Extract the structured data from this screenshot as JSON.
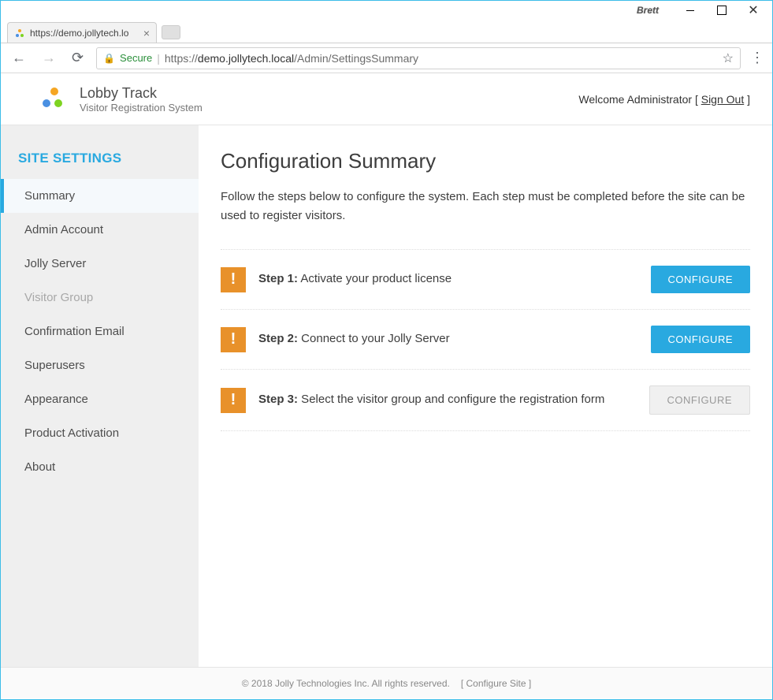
{
  "window": {
    "user": "Brett"
  },
  "browser": {
    "tab_title": "https://demo.jollytech.lo",
    "secure_label": "Secure",
    "url_host": "demo.jollytech.local",
    "url_path": "/Admin/SettingsSummary",
    "url_prefix": "https://"
  },
  "header": {
    "app_name": "Lobby Track",
    "app_sub": "Visitor Registration System",
    "welcome_prefix": "Welcome Administrator [ ",
    "signout": "Sign Out",
    "welcome_suffix": " ]"
  },
  "sidebar": {
    "title": "SITE SETTINGS",
    "items": {
      "summary": "Summary",
      "admin": "Admin Account",
      "jolly": "Jolly Server",
      "visitor": "Visitor Group",
      "confirm": "Confirmation Email",
      "superusers": "Superusers",
      "appearance": "Appearance",
      "activation": "Product Activation",
      "about": "About"
    }
  },
  "main": {
    "title": "Configuration Summary",
    "intro": "Follow the steps below to configure the system. Each step must be completed before the site can be used to register visitors.",
    "configure_label": "CONFIGURE",
    "steps": {
      "s1_num": "Step 1:",
      "s1_txt": " Activate your product license",
      "s2_num": "Step 2:",
      "s2_txt": " Connect to your Jolly Server",
      "s3_num": "Step 3:",
      "s3_txt": " Select the visitor group and configure the registration form"
    }
  },
  "footer": {
    "copyright": "© 2018 Jolly Technologies Inc. All rights reserved.",
    "configure_site": "[ Configure Site ]"
  }
}
